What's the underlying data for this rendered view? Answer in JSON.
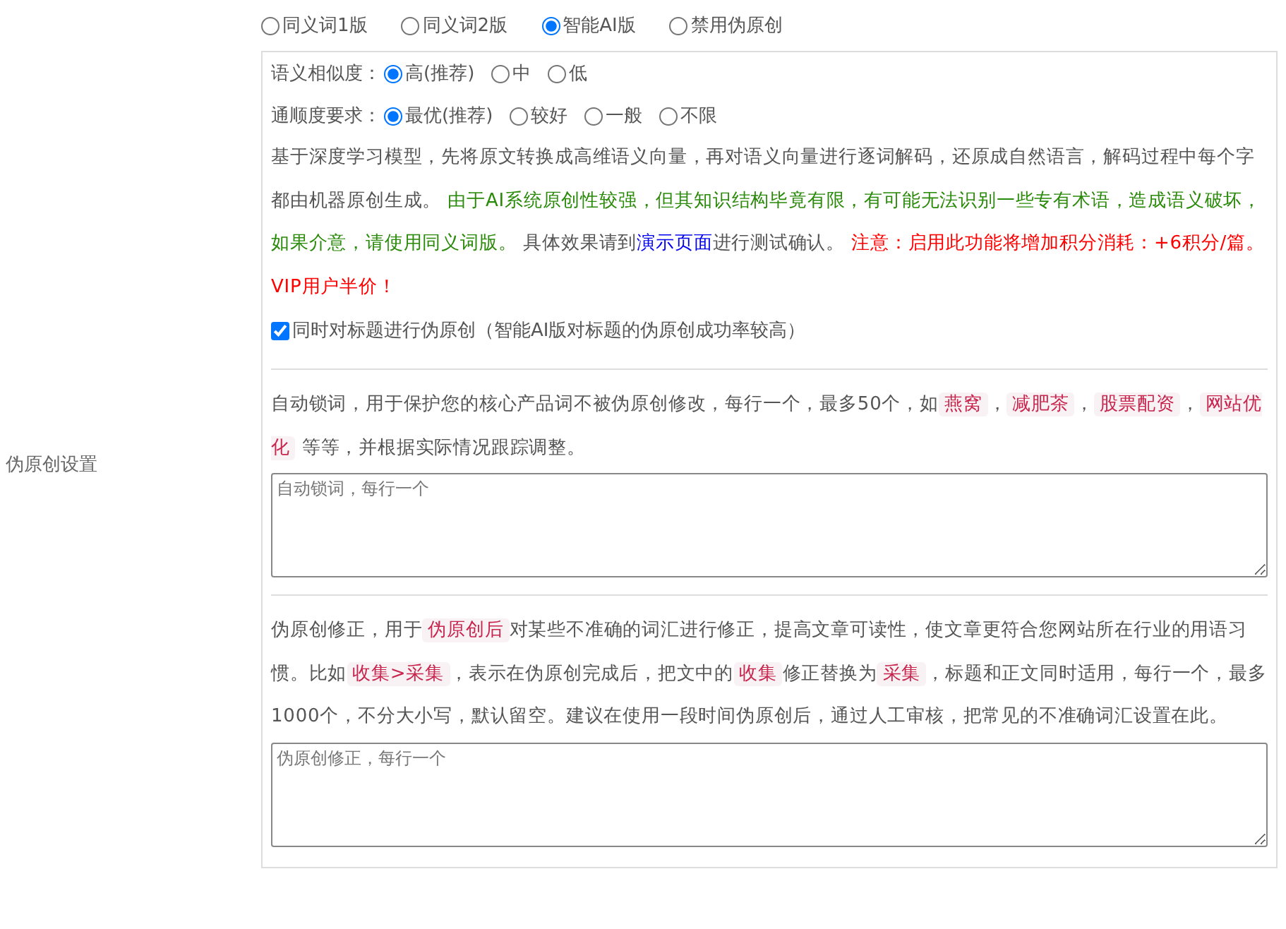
{
  "sidebar_label": "伪原创设置",
  "modes": [
    {
      "label": "同义词1版",
      "selected": false
    },
    {
      "label": "同义词2版",
      "selected": false
    },
    {
      "label": "智能AI版",
      "selected": true
    },
    {
      "label": "禁用伪原创",
      "selected": false
    }
  ],
  "similarity": {
    "label": "语义相似度：",
    "options": [
      {
        "label": "高(推荐)",
        "selected": true
      },
      {
        "label": "中",
        "selected": false
      },
      {
        "label": "低",
        "selected": false
      }
    ]
  },
  "fluency": {
    "label": "通顺度要求：",
    "options": [
      {
        "label": "最优(推荐)",
        "selected": true
      },
      {
        "label": "较好",
        "selected": false
      },
      {
        "label": "一般",
        "selected": false
      },
      {
        "label": "不限",
        "selected": false
      }
    ]
  },
  "description": [
    {
      "kind": "plain",
      "text": "基于深度学习模型，先将原文转换成高维语义向量，再对语义向量进行逐词解码，还原成自然语言，解码过程中每个字都由机器原创生成。 "
    },
    {
      "kind": "caution",
      "text": "由于AI系统原创性较强，但其知识结构毕竟有限，有可能无法识别一些专有术语，造成语义破坏，如果介意，请使用同义词版。"
    },
    {
      "kind": "plain",
      "text": " 具体效果请到"
    },
    {
      "kind": "link",
      "text": "演示页面"
    },
    {
      "kind": "plain",
      "text": "进行测试确认。 "
    },
    {
      "kind": "notice",
      "text": "注意：启用此功能将增加积分消耗：+6积分/篇。VIP用户半价！"
    }
  ],
  "title_option": {
    "label": "同时对标题进行伪原创（智能AI版对标题的伪原创成功率较高）",
    "checked": true
  },
  "lock_words": {
    "segments": [
      {
        "kind": "plain",
        "text": "自动锁词，用于保护您的核心产品词不被伪原创修改，每行一个，最多50个，如"
      },
      {
        "kind": "code",
        "text": "燕窝"
      },
      {
        "kind": "plain",
        "text": "，"
      },
      {
        "kind": "code",
        "text": "减肥茶"
      },
      {
        "kind": "plain",
        "text": "，"
      },
      {
        "kind": "code",
        "text": "股票配资"
      },
      {
        "kind": "plain",
        "text": "，"
      },
      {
        "kind": "code",
        "text": "网站优化"
      },
      {
        "kind": "plain",
        "text": " 等等，并根据实际情况跟踪调整。"
      }
    ],
    "placeholder": "自动锁词，每行一个"
  },
  "corrections": {
    "segments": [
      {
        "kind": "plain",
        "text": "伪原创修正，用于"
      },
      {
        "kind": "code",
        "text": "伪原创后"
      },
      {
        "kind": "plain",
        "text": "对某些不准确的词汇进行修正，提高文章可读性，使文章更符合您网站所在行业的用语习惯。比如"
      },
      {
        "kind": "code",
        "text": "收集>采集"
      },
      {
        "kind": "plain",
        "text": "，表示在伪原创完成后，把文中的"
      },
      {
        "kind": "code",
        "text": "收集"
      },
      {
        "kind": "plain",
        "text": "修正替换为"
      },
      {
        "kind": "code",
        "text": "采集"
      },
      {
        "kind": "plain",
        "text": "，标题和正文同时适用，每行一个，最多1000个，不分大小写，默认留空。建议在使用一段时间伪原创后，通过人工审核，把常见的不准确词汇设置在此。"
      }
    ],
    "placeholder": "伪原创修正，每行一个"
  }
}
